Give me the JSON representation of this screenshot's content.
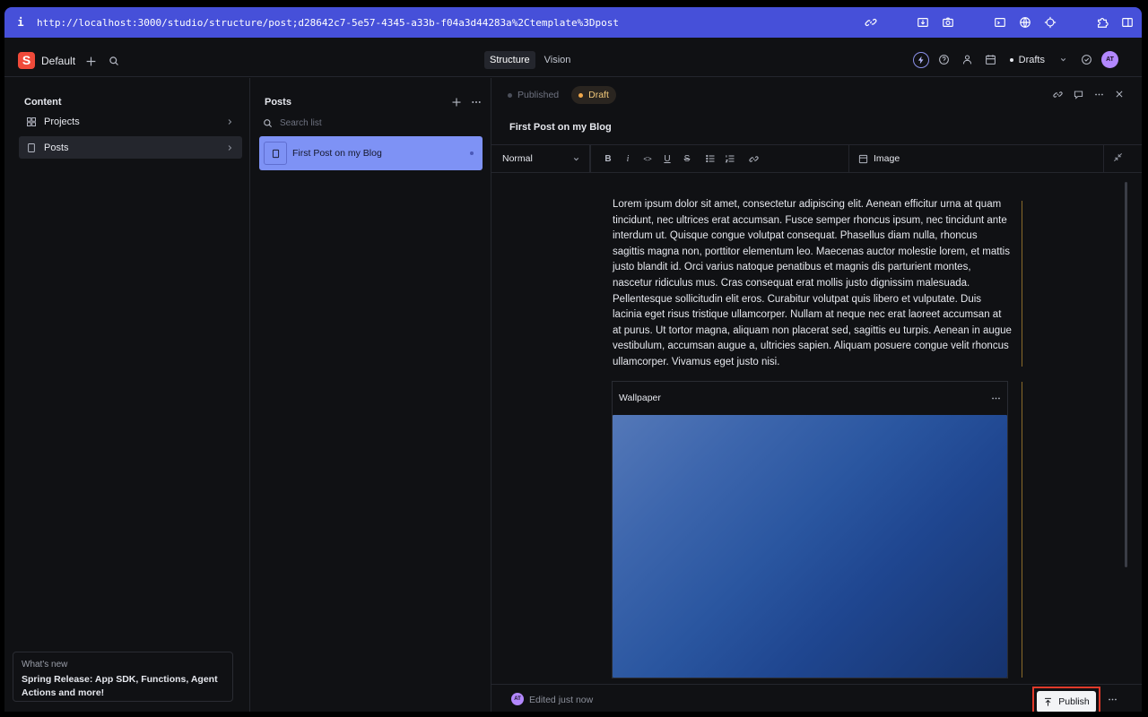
{
  "browser": {
    "info_label": "i",
    "url": "http://localhost:3000/studio/structure/post;d28642c7-5e57-4345-a33b-f04a3d44283a%2Ctemplate%3Dpost",
    "icons": [
      "link-icon",
      "download-icon",
      "camera-icon",
      "terminal-icon",
      "globe-icon",
      "crosshair-icon",
      "extension-icon",
      "sidebar-icon"
    ]
  },
  "topnav": {
    "logo_letter": "S",
    "workspace": "Default",
    "tabs": [
      "Structure",
      "Vision"
    ],
    "active_tab": "Structure",
    "perspective": "Drafts",
    "avatar_initials": "AT"
  },
  "content_pane": {
    "title": "Content",
    "items": [
      {
        "label": "Projects",
        "icon": "grid-icon"
      },
      {
        "label": "Posts",
        "icon": "document-icon"
      }
    ],
    "whats_new": {
      "kicker": "What's new",
      "text": "Spring Release: App SDK, Functions, Agent Actions and more!"
    }
  },
  "posts_pane": {
    "title": "Posts",
    "search_placeholder": "Search list",
    "items": [
      {
        "title": "First Post on my Blog"
      }
    ]
  },
  "editor": {
    "status": {
      "published": "Published",
      "draft": "Draft"
    },
    "document_title": "First Post on my Blog",
    "toolbar": {
      "style": "Normal",
      "bold": "B",
      "italic": "i",
      "code": "<>",
      "underline": "U",
      "strike": "S",
      "insert_image": "Image"
    },
    "body": "Lorem ipsum dolor sit amet, consectetur adipiscing elit. Aenean efficitur urna at quam tincidunt, nec ultrices erat accumsan. Fusce semper rhoncus ipsum, nec tincidunt ante interdum ut. Quisque congue volutpat consequat. Phasellus diam nulla, rhoncus sagittis magna non, porttitor elementum leo. Maecenas auctor molestie lorem, et mattis justo blandit id. Orci varius natoque penatibus et magnis dis parturient montes, nascetur ridiculus mus. Cras consequat erat mollis justo dignissim malesuada. Pellentesque sollicitudin elit eros. Curabitur volutpat quis libero et vulputate. Duis lacinia eget risus tristique ullamcorper. Nullam at neque nec erat laoreet accumsan at at purus. Ut tortor magna, aliquam non placerat sed, sagittis eu turpis. Aenean in augue vestibulum, accumsan augue a, ultricies sapien. Aliquam posuere congue velit rhoncus ullamcorper. Vivamus eget justo nisi.",
    "image_block": {
      "label": "Wallpaper"
    },
    "footer": {
      "avatar_initials": "AT",
      "edit_status": "Edited just now",
      "publish_label": "Publish"
    }
  },
  "colors": {
    "accent": "#4650d9",
    "selected_row": "#7e92f5",
    "draft": "#f1a84b",
    "highlight_border": "#e03a2a"
  }
}
